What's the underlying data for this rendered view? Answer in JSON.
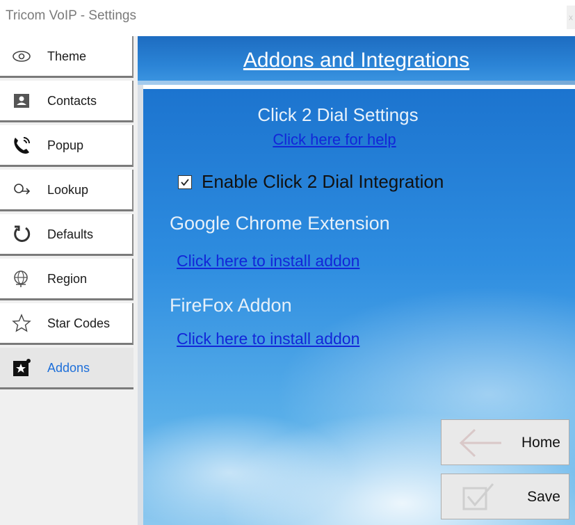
{
  "window": {
    "title": "Tricom VoIP - Settings",
    "close_label": "x"
  },
  "sidebar": {
    "items": [
      {
        "label": "Theme",
        "icon": "eye-icon"
      },
      {
        "label": "Contacts",
        "icon": "contact-card-icon"
      },
      {
        "label": "Popup",
        "icon": "phone-ringing-icon"
      },
      {
        "label": "Lookup",
        "icon": "lookup-arrow-icon"
      },
      {
        "label": "Defaults",
        "icon": "reset-icon"
      },
      {
        "label": "Region",
        "icon": "globe-icon"
      },
      {
        "label": "Star Codes",
        "icon": "star-icon"
      },
      {
        "label": "Addons",
        "icon": "addon-star-icon"
      }
    ],
    "active": "Addons"
  },
  "header": {
    "title": "Addons and Integrations"
  },
  "main": {
    "section_title": "Click 2 Dial Settings",
    "help_link": "Click here for help",
    "enable_checkbox": {
      "label": "Enable Click 2 Dial Integration",
      "checked": true,
      "mark": "☑"
    },
    "chrome": {
      "heading": "Google Chrome Extension",
      "link": "Click here to install addon"
    },
    "firefox": {
      "heading": "FireFox Addon",
      "link": "Click here to install addon"
    }
  },
  "buttons": {
    "home_label": "Home",
    "save_label": "Save"
  },
  "colors": {
    "accent": "#1e6fd9",
    "link": "#1226d8",
    "header_blue": "#2b84d6"
  }
}
